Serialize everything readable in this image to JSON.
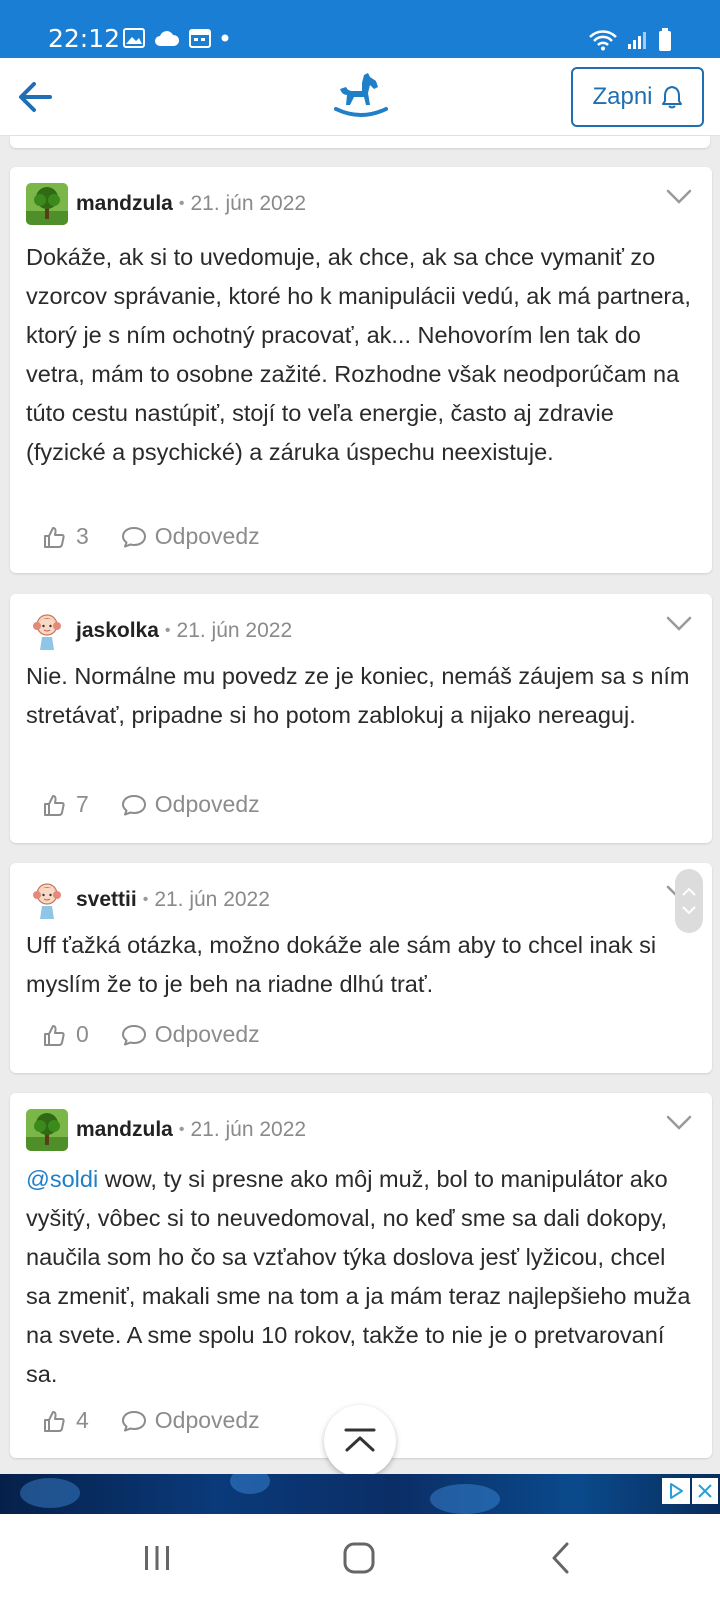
{
  "status_bar": {
    "time": "22:12",
    "background": "#1a7fd4",
    "left_icons": [
      "image-icon",
      "cloud-icon",
      "calendar-icon",
      "dot-icon"
    ],
    "right_icons": [
      "wifi-icon",
      "signal-icon",
      "battery-icon"
    ]
  },
  "header": {
    "back_icon": "arrow-left-icon",
    "logo_icon": "rocking-horse-icon",
    "follow_label": "Zapni",
    "follow_icon": "bell-icon",
    "accent": "#1f6fb2"
  },
  "comments": [
    {
      "username": "mandzula",
      "date": "21. jún 2022",
      "avatar": "tree-avatar",
      "text": "Dokáže, ak si to uvedomuje, ak chce, ak sa chce vymaniť zo vzorcov správanie, ktoré ho k manipulácii vedú, ak má partnera, ktorý je s ním ochotný pracovať, ak... Nehovorím len tak do vetra, mám to osobne zažité. Rozhodne však neodporúčam na túto cestu nastúpiť, stojí to veľa energie, často aj zdravie (fyzické a psychické) a záruka úspechu neexistuje.",
      "likes": "3",
      "reply_label": "Odpovedz"
    },
    {
      "username": "jaskolka",
      "date": "21. jún 2022",
      "avatar": "girl-avatar",
      "text": "Nie. Normálne mu povedz ze je koniec, nemáš záujem sa s ním stretávať, pripadne si ho potom zablokuj a nijako nereaguj.",
      "likes": "7",
      "reply_label": "Odpovedz"
    },
    {
      "username": "svettii",
      "date": "21. jún 2022",
      "avatar": "girl-avatar",
      "text": "Uff ťažká otázka, možno dokáže ale sám aby to chcel inak si myslím že to je beh na riadne dlhú trať.",
      "likes": "0",
      "reply_label": "Odpovedz"
    },
    {
      "username": "mandzula",
      "date": "21. jún 2022",
      "avatar": "tree-avatar",
      "mention": "@soldi",
      "text": " wow, ty si presne ako môj muž, bol to manipulátor ako vyšitý, vôbec si to neuvedomoval, no keď sme sa dali dokopy, naučila som ho čo sa vzťahov týka doslova jesť lyžicou, chcel sa zmeniť, makali sme na tom a ja mám teraz najlepšieho muža na svete. A sme spolu 10 rokov, takže to nie je o pretvarovaní sa.",
      "likes": "4",
      "reply_label": "Odpovedz"
    }
  ],
  "ad": {
    "choices_icon": "adchoices-icon",
    "close_icon": "close-icon"
  },
  "nav": {
    "icons": [
      "recent-apps-icon",
      "home-icon",
      "back-icon"
    ]
  }
}
